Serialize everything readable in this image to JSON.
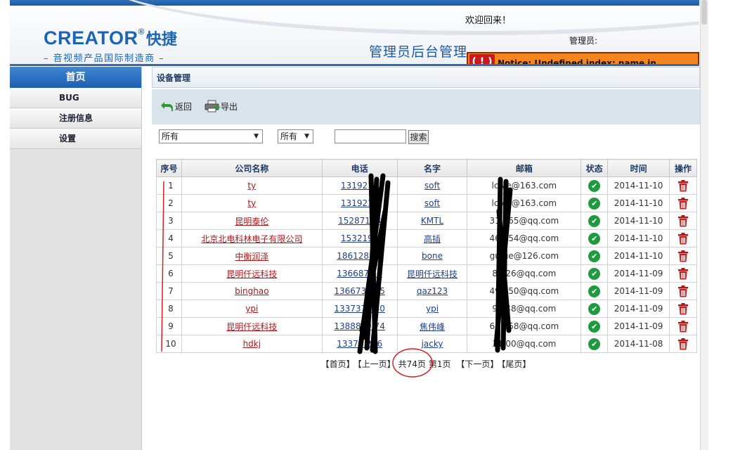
{
  "header": {
    "logo_main": "CREATOR",
    "logo_reg": "®",
    "logo_cn": "快捷",
    "logo_sub": "– 音视频产品国际制造商 –",
    "welcome": "欢迎回来！",
    "admin_label": "管理员:",
    "title": "管理员后台管理",
    "notice_icon": "( ! )",
    "notice": "Notice: Undefined index: name in"
  },
  "sidebar": {
    "home": "首页",
    "items": [
      {
        "label": "BUG"
      },
      {
        "label": "注册信息"
      },
      {
        "label": "设置"
      }
    ]
  },
  "main": {
    "panel_title": "设备管理",
    "toolbar": {
      "back": "返回",
      "export": "导出"
    },
    "filters": {
      "select1": "所有",
      "select2": "所有",
      "search_value": "",
      "search_button": "搜索"
    },
    "table": {
      "columns": [
        "序号",
        "公司名称",
        "电话",
        "名字",
        "邮箱",
        "状态",
        "时间",
        "操作"
      ],
      "rows": [
        {
          "idx": "1",
          "company": "ty",
          "phone": "1319211",
          "name": "soft",
          "email": "lc      ve@163.com",
          "date": "2014-11-10"
        },
        {
          "idx": "2",
          "company": "ty",
          "phone": "1319211",
          "name": "soft",
          "email": "lc      ve@163.com",
          "date": "2014-11-10"
        },
        {
          "idx": "3",
          "company": "昆明泰伦",
          "phone": "15287198",
          "name": "KMTL",
          "email": "31   365@qq.com",
          "date": "2014-11-10"
        },
        {
          "idx": "4",
          "company": "北京北电科林电子有限公司",
          "phone": "1532198",
          "name": "高插",
          "email": "46   254@qq.com",
          "date": "2014-11-10"
        },
        {
          "idx": "5",
          "company": "中衡润泽",
          "phone": "1861281    5",
          "name": "bone",
          "email": "gu    ue@126.com",
          "date": "2014-11-10"
        },
        {
          "idx": "6",
          "company": "昆明仟远科技",
          "phone": "1366873    6",
          "name": "昆明仟远科技",
          "email": "8   526@qq.com",
          "date": "2014-11-09"
        },
        {
          "idx": "7",
          "company": "binghao",
          "phone": "1366731   15",
          "name": "qaz123",
          "email": "49   750@qq.com",
          "date": "2014-11-09"
        },
        {
          "idx": "8",
          "company": "ypi",
          "phone": "1337371   40",
          "name": "ypi",
          "email": "9   048@qq.com",
          "date": "2014-11-09"
        },
        {
          "idx": "9",
          "company": "昆明仟远科技",
          "phone": "1388879   74",
          "name": "焦伟峰",
          "email": "69   358@qq.com",
          "date": "2014-11-09"
        },
        {
          "idx": "10",
          "company": "hdkj",
          "phone": "13373   206",
          "name": "jacky",
          "email": "31   00@qq.com",
          "date": "2014-11-08"
        }
      ]
    },
    "pager": {
      "first": "【首页】",
      "prev": "【上一页】",
      "total": "共74页",
      "current": "第1页",
      "next": "【下一页】",
      "last": "【尾页】"
    }
  },
  "colors": {
    "brand_blue": "#1b65b7",
    "link_red": "#b0161a",
    "status_green": "#1f9a3e",
    "notice_orange": "#f5861f"
  },
  "icons": {
    "back": "back-arrow-icon",
    "export": "printer-export-icon",
    "status": "check-circle-icon",
    "delete": "trash-icon"
  }
}
